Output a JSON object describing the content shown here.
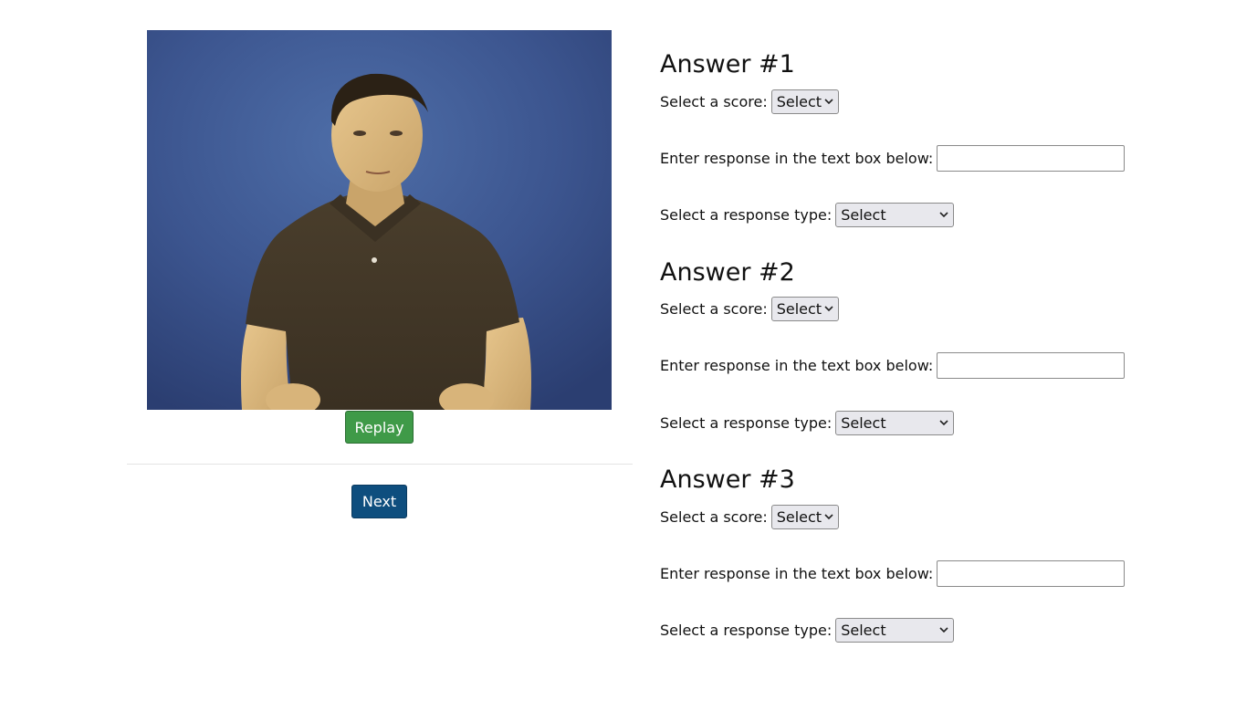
{
  "video": {
    "replay_label": "Replay"
  },
  "navigation": {
    "next_label": "Next"
  },
  "answers": [
    {
      "heading": "Answer #1",
      "score_label": "Select a score:",
      "score_value": "Select",
      "response_label": "Enter response in the text box below:",
      "response_value": "",
      "type_label": "Select a response type:",
      "type_value": "Select"
    },
    {
      "heading": "Answer #2",
      "score_label": "Select a score:",
      "score_value": "Select",
      "response_label": "Enter response in the text box below:",
      "response_value": "",
      "type_label": "Select a response type:",
      "type_value": "Select"
    },
    {
      "heading": "Answer #3",
      "score_label": "Select a score:",
      "score_value": "Select",
      "response_label": "Enter response in the text box below:",
      "response_value": "",
      "type_label": "Select a response type:",
      "type_value": "Select"
    }
  ],
  "colors": {
    "replay_button": "#3f9a48",
    "next_button": "#0e4e7e",
    "video_background": "#3d5690"
  },
  "icons": {
    "select_arrow": "chevron-down-icon"
  }
}
